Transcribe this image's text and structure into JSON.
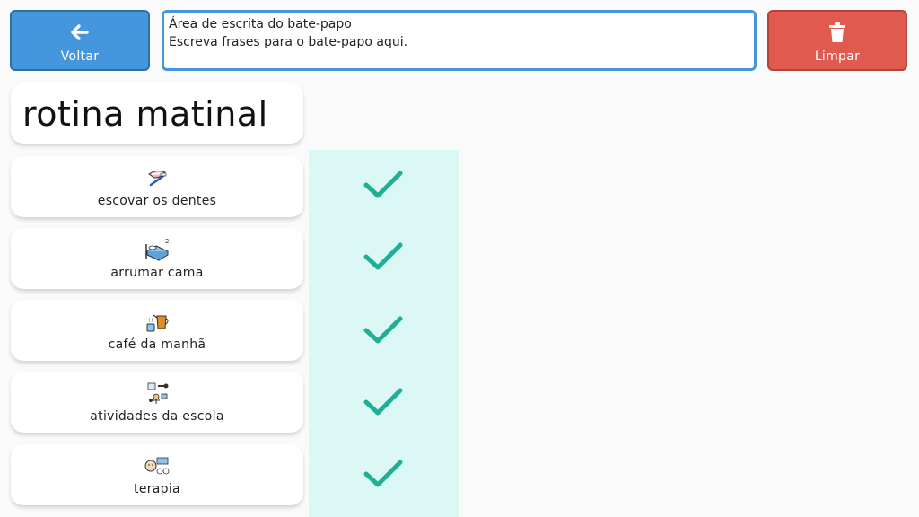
{
  "header": {
    "back_label": "Voltar",
    "clear_label": "Limpar",
    "chat_title": "Área de escrita do bate-papo",
    "chat_placeholder": "Escreva frases para o bate-papo aqui."
  },
  "board": {
    "title": "rotina matinal",
    "items": [
      {
        "label": "escovar os dentes",
        "icon": "toothbrush-icon",
        "done": true
      },
      {
        "label": "arrumar cama",
        "icon": "bed-icon",
        "done": true
      },
      {
        "label": "café da manhã",
        "icon": "coffee-icon",
        "done": true
      },
      {
        "label": "atividades da escola",
        "icon": "school-activities-icon",
        "done": true
      },
      {
        "label": "terapia",
        "icon": "therapy-icon",
        "done": true
      }
    ]
  },
  "colors": {
    "back": "#4596dc",
    "clear": "#e05a4f",
    "check": "#1fae96",
    "check_column": "#dcf8f4"
  }
}
